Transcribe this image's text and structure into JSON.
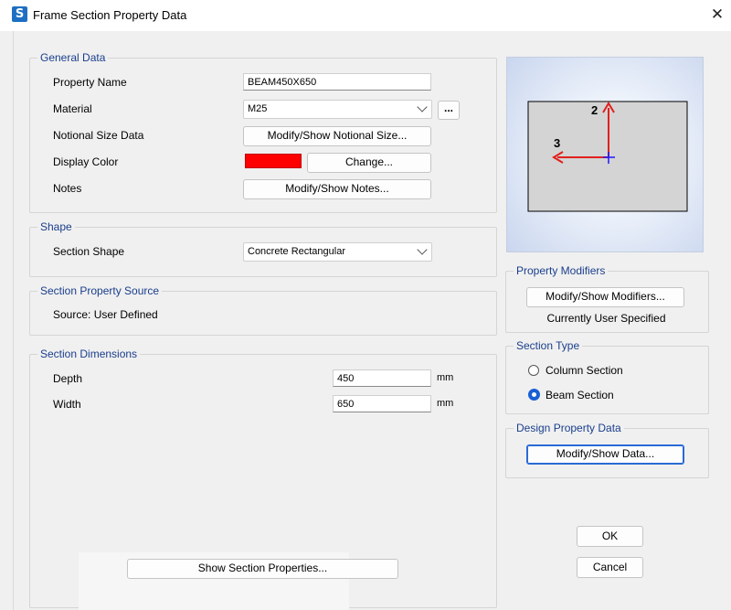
{
  "window": {
    "app_icon_letter": "S",
    "title": "Frame Section Property Data",
    "close_glyph": "✕"
  },
  "general": {
    "legend": "General Data",
    "property_name_label": "Property Name",
    "property_name_value": "BEAM450X650",
    "material_label": "Material",
    "material_value": "M25",
    "material_more_label": "...",
    "notional_label": "Notional Size Data",
    "notional_button": "Modify/Show Notional Size...",
    "display_color_label": "Display Color",
    "display_color_value": "#ff0000",
    "change_button": "Change...",
    "notes_label": "Notes",
    "notes_button": "Modify/Show Notes..."
  },
  "shape": {
    "legend": "Shape",
    "section_shape_label": "Section Shape",
    "section_shape_value": "Concrete Rectangular"
  },
  "source": {
    "legend": "Section Property Source",
    "source_text": "Source:  User Defined"
  },
  "dimensions": {
    "legend": "Section Dimensions",
    "depth_label": "Depth",
    "depth_value": "450",
    "depth_unit": "mm",
    "width_label": "Width",
    "width_value": "650",
    "width_unit": "mm"
  },
  "preview": {
    "axis_2_label": "2",
    "axis_3_label": "3",
    "axis_color": "#e0201c",
    "centroid_color": "#1a1aff"
  },
  "modifiers": {
    "legend": "Property Modifiers",
    "button": "Modify/Show Modifiers...",
    "status": "Currently User Specified"
  },
  "section_type": {
    "legend": "Section Type",
    "options": [
      {
        "label": "Column Section",
        "selected": false
      },
      {
        "label": "Beam Section",
        "selected": true
      }
    ]
  },
  "design": {
    "legend": "Design Property Data",
    "button": "Modify/Show Data..."
  },
  "footer": {
    "show_props_button": "Show Section Properties...",
    "ok_button": "OK",
    "cancel_button": "Cancel"
  }
}
